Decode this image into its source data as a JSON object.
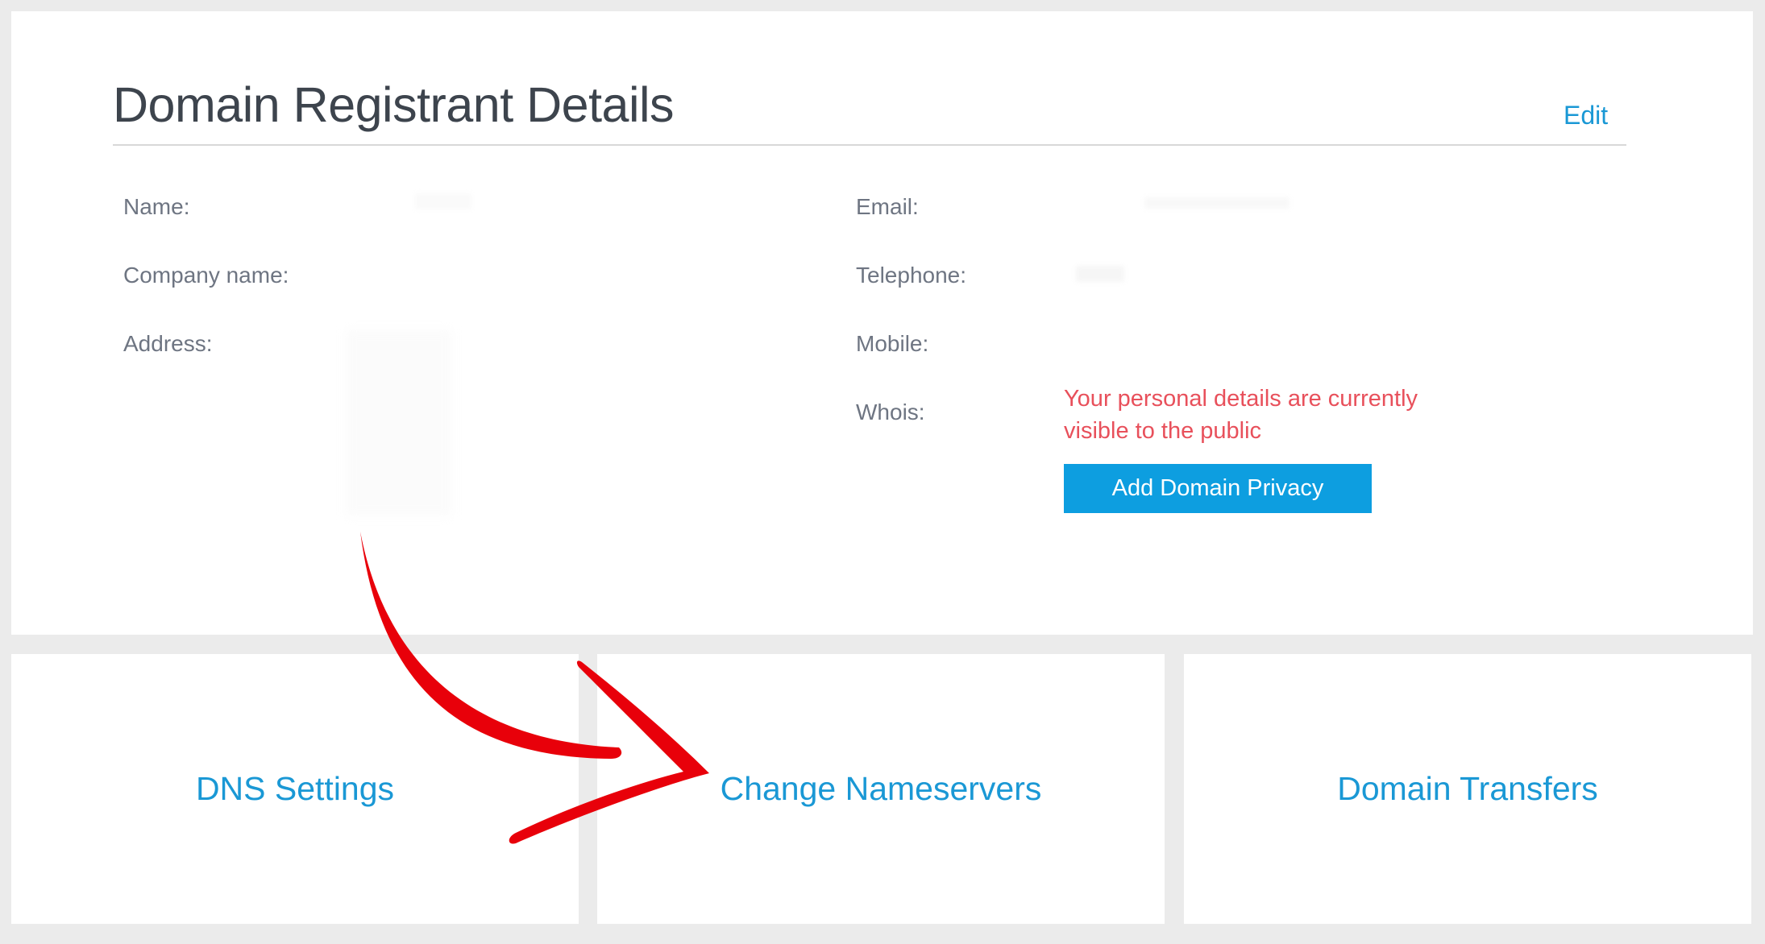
{
  "registrant": {
    "title": "Domain Registrant Details",
    "edit_label": "Edit",
    "labels": {
      "name": "Name:",
      "company": "Company name:",
      "address": "Address:",
      "email": "Email:",
      "telephone": "Telephone:",
      "mobile": "Mobile:",
      "whois": "Whois:"
    },
    "whois_status": "Your personal details are currently visible to the public",
    "privacy_button_label": "Add Domain Privacy",
    "status_color": "#e8505b",
    "button_color": "#0d9ee0"
  },
  "tiles": [
    {
      "label": "DNS Settings"
    },
    {
      "label": "Change Nameservers"
    },
    {
      "label": "Domain Transfers"
    }
  ],
  "annotation": {
    "icon": "red-curved-arrow-icon",
    "color": "#e8000a"
  },
  "colors": {
    "accent": "#1a98d5",
    "title": "#3d444d",
    "label": "#6e7582",
    "background": "#ebebeb"
  }
}
